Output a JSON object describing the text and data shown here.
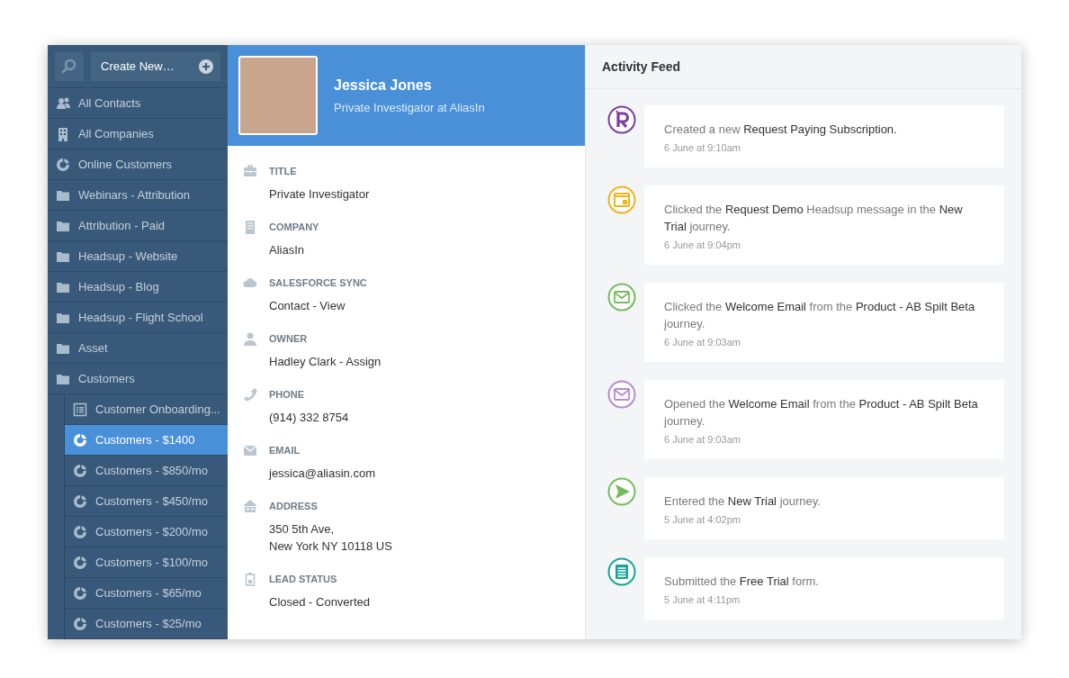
{
  "sidebar": {
    "create_button": "Create New…",
    "items": [
      {
        "label": "All Contacts",
        "kind": "contacts",
        "selected": false
      },
      {
        "label": "All Companies",
        "kind": "companies",
        "selected": false
      },
      {
        "label": "Online Customers",
        "kind": "segment",
        "selected": false
      },
      {
        "label": "Webinars - Attribution",
        "kind": "folder",
        "selected": false
      },
      {
        "label": "Attribution - Paid",
        "kind": "folder",
        "selected": false
      },
      {
        "label": "Headsup - Website",
        "kind": "folder",
        "selected": false
      },
      {
        "label": "Headsup - Blog",
        "kind": "folder",
        "selected": false
      },
      {
        "label": "Headsup - Flight School",
        "kind": "folder",
        "selected": false
      },
      {
        "label": "Asset",
        "kind": "folder",
        "selected": false
      },
      {
        "label": "Customers",
        "kind": "folder",
        "selected": false,
        "children": [
          {
            "label": "Customer Onboarding...",
            "kind": "list",
            "selected": false
          },
          {
            "label": "Customers - $1400",
            "kind": "segment",
            "selected": true
          },
          {
            "label": "Customers - $850/mo",
            "kind": "segment",
            "selected": false
          },
          {
            "label": "Customers - $450/mo",
            "kind": "segment",
            "selected": false
          },
          {
            "label": "Customers - $200/mo",
            "kind": "segment",
            "selected": false
          },
          {
            "label": "Customers - $100/mo",
            "kind": "segment",
            "selected": false
          },
          {
            "label": "Customers - $65/mo",
            "kind": "segment",
            "selected": false
          },
          {
            "label": "Customers - $25/mo",
            "kind": "segment",
            "selected": false
          }
        ]
      }
    ]
  },
  "profile": {
    "name": "Jessica Jones",
    "subtitle": "Private Investigator at AliasIn",
    "fields": [
      {
        "kind": "briefcase",
        "label": "TITLE",
        "value": "Private Investigator"
      },
      {
        "kind": "building",
        "label": "COMPANY",
        "value": "AliasIn"
      },
      {
        "kind": "cloud",
        "label": "SALESFORCE SYNC",
        "value": "Contact - View"
      },
      {
        "kind": "person",
        "label": "OWNER",
        "value": "Hadley Clark - Assign"
      },
      {
        "kind": "phone",
        "label": "PHONE",
        "value": "(914) 332 8754"
      },
      {
        "kind": "mail",
        "label": "EMAIL",
        "value": "jessica@aliasin.com"
      },
      {
        "kind": "house",
        "label": "ADDRESS",
        "value": "350 5th Ave,\nNew York NY 10118 US"
      },
      {
        "kind": "battery",
        "label": "LEAD STATUS",
        "value": "Closed - Converted"
      }
    ]
  },
  "activity_feed": {
    "title": "Activity Feed",
    "items": [
      {
        "kind": "letter",
        "color": "#7b3f9e",
        "text": "Created a new **Request Paying Subscription.**",
        "time": "6 June at 9:10am"
      },
      {
        "kind": "window",
        "color": "#f2b21b",
        "text": "Clicked the **Request Demo** Headsup message in the **New Trial** journey.",
        "time": "6 June at 9:04pm"
      },
      {
        "kind": "mail",
        "color": "#74bd5f",
        "text": "Clicked the **Welcome Email** from the **Product - AB Spilt Beta** journey.",
        "time": "6 June at 9:03am"
      },
      {
        "kind": "mail",
        "color": "#b98ad3",
        "text": "Opened the **Welcome Email** from the **Product - AB Spilt Beta** journey.",
        "time": "6 June at 9:03am"
      },
      {
        "kind": "send",
        "color": "#74bd5f",
        "text": "Entered the **New Trial** journey.",
        "time": "5 June at 4:02pm"
      },
      {
        "kind": "form",
        "color": "#16a596",
        "text": "Submitted the **Free Trial** form.",
        "time": "5 June at 4:11pm"
      }
    ]
  }
}
